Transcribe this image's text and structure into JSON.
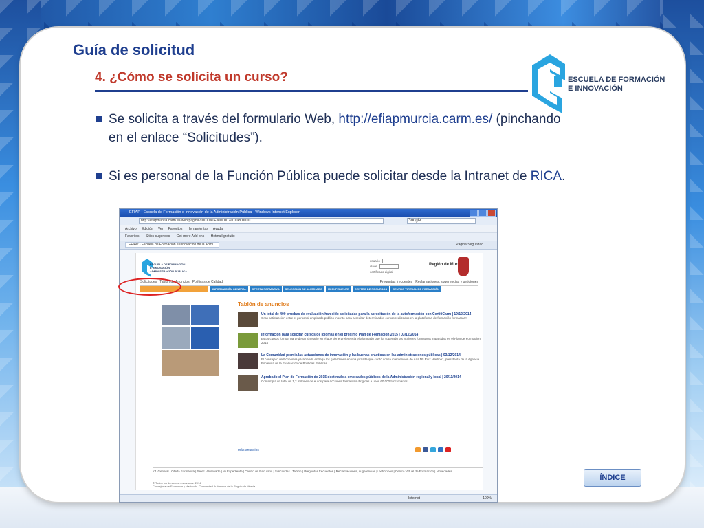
{
  "slide": {
    "title": "Guía de solicitud",
    "subtitle": "4. ¿Cómo se solicita un curso?",
    "logo_line1": "ESCUELA DE FORMACIÓN",
    "logo_line2": "E INNOVACIÓN",
    "bullet1_text": "Se solicita a través del formulario Web, ",
    "bullet1_link": "http://efiapmurcia.carm.es/",
    "bullet1_tail": " (pinchando en el enlace “Solicitudes”).",
    "bullet2_text": "Si es personal de la Función Pública puede solicitar desde la Intranet de ",
    "bullet2_link": "RICA",
    "bullet2_tail": ".",
    "indice_button": "ÍNDICE",
    "colors": {
      "title": "#1f3f8f",
      "subtitle": "#c0392b",
      "accent": "#2a7fc8",
      "highlight_circle": "#dd2222"
    }
  },
  "browser": {
    "window_title": "EFIAP - Escuela de Formación e Innovación de la Administración Pública - Windows Internet Explorer",
    "address": "http://efiapmurcia.carm.es/web/pagina?IDCONTENIDO=1&IDTIPO=100",
    "search_placeholder": "Google",
    "menu": [
      "Archivo",
      "Edición",
      "Ver",
      "Favoritos",
      "Herramientas",
      "Ayuda"
    ],
    "favorites": [
      "Favoritos",
      "Sitios sugeridos",
      "Get more Add-ons",
      "Hotmail gratuito"
    ],
    "tab_title": "EFIAP - Escuela de Formación e Innovación de la Admi...",
    "tab_tools": [
      "Página",
      "Seguridad"
    ],
    "status_zone": "Internet",
    "status_zoom": "100%"
  },
  "site": {
    "logo_text1": "ESCUELA DE FORMACIÓN",
    "logo_text2": "E INNOVACIÓN",
    "logo_text3": "ADMINISTRACIÓN PÚBLICA",
    "login_user": "usuario",
    "login_pass": "clave",
    "cert": "certificado digital",
    "region": "Región de Murcia",
    "top_links": [
      "Solicitudes",
      "Tablón de Anuncios",
      "Políticas de Calidad"
    ],
    "top_links_right": [
      "Preguntas frecuentes",
      "Reclamaciones, sugerencias y peticiones"
    ],
    "nav": [
      "INFORMACIÓN GENERAL",
      "OFERTA FORMATIVA",
      "SELECCIÓN DE ALUMNADO",
      "MI EXPEDIENTE",
      "CENTRO DE RECURSOS",
      "CENTRO VIRTUAL DE FORMACIÓN"
    ],
    "board_title": "Tablón de anuncios",
    "news": [
      {
        "title": "Un total de 400 pruebas de evaluación han sido solicitadas para la acreditación de la autoformación con CertifiCarm",
        "date": "19/12/2014",
        "desc": "Gran satisfacción entre el personal empleado público inscrito para acreditar determinados cursos realizados en la plataforma de formación formaCarm"
      },
      {
        "title": "Información para solicitar cursos de idiomas en el próximo Plan de Formación 2015",
        "date": "03/12/2014",
        "desc": "Estos cursos forman parte de un itinerario en el que tiene preferencia el alumnado que ha superado las acciones formativas impartidas en el Plan de Formación 2014"
      },
      {
        "title": "La Comunidad premia las actuaciones de innovación y las buenas prácticas en las administraciones públicas",
        "date": "03/12/2014",
        "desc": "El consejero de Economía y Hacienda entrega los galardones en una jornada que contó con la intervención de Ana Mª Ruiz Martínez, presidenta de la Agencia Española de la Evaluación de Políticas Públicas"
      },
      {
        "title": "Aprobado el Plan de Formación de 2015 destinado a empleados públicos de la Administración regional y local",
        "date": "20/11/2014",
        "desc": "Contempla un total de 1,2 millones de euros para acciones formativas dirigidas a unos 60.000 funcionarios"
      }
    ],
    "more": "más anuncios",
    "footer_links": "Inf. General | Oferta Formativa | Selec. Alumnado | Mi Expediente | Centro de Recursos | Solicitudes | Tablón | Preguntas frecuentes | Reclamaciones, sugerencias y peticiones | Centro Virtual de Formación | Novedades",
    "copyright1": "© Todos los derechos reservados. 2014",
    "copyright2": "Consejería de Economía y Hacienda. Comunidad Autónoma de la Región de Murcia"
  }
}
